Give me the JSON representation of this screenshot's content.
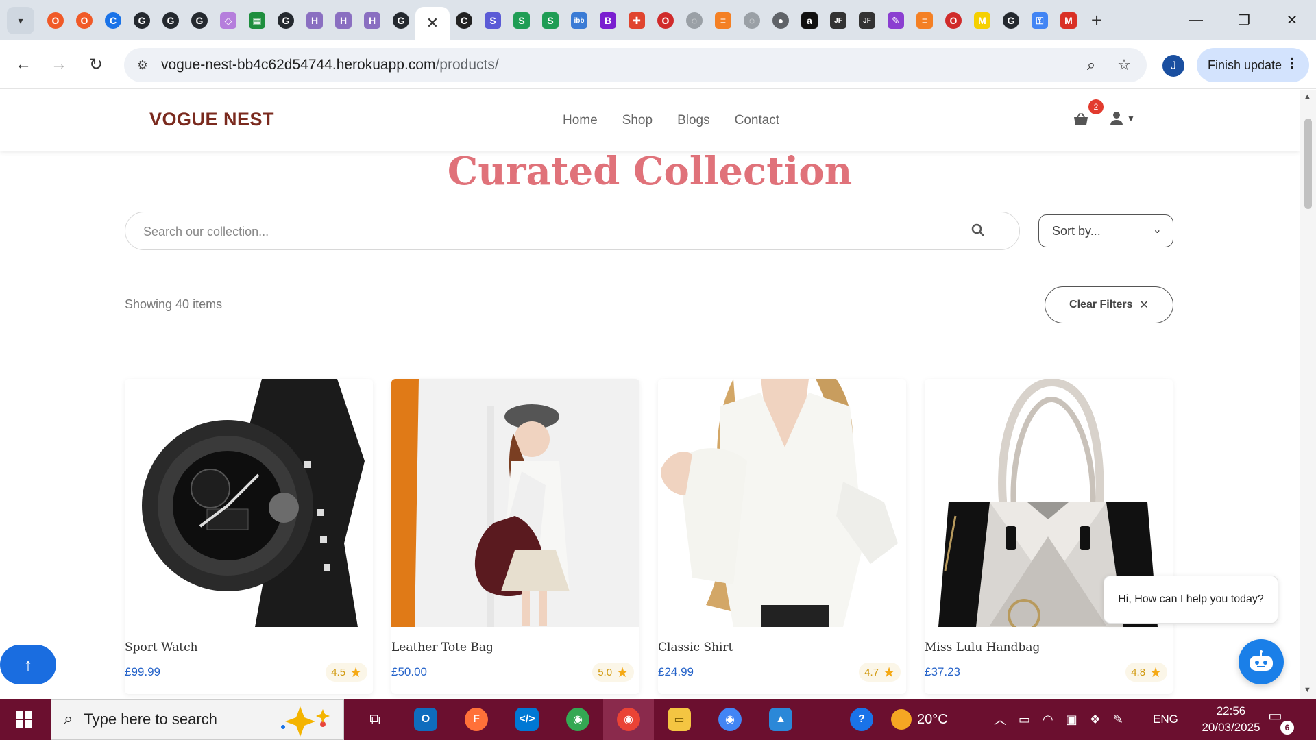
{
  "browser": {
    "tab_favicons": [
      {
        "name": "opera-red-icon",
        "color": "#f05a28",
        "glyph": "O",
        "round": true
      },
      {
        "name": "opera-red-icon",
        "color": "#f05a28",
        "glyph": "O",
        "round": true
      },
      {
        "name": "chrome-blue-icon",
        "color": "#1a73e8",
        "glyph": "C",
        "round": true
      },
      {
        "name": "github-icon",
        "color": "#24292f",
        "glyph": "G",
        "round": true
      },
      {
        "name": "github-icon",
        "color": "#24292f",
        "glyph": "G",
        "round": true
      },
      {
        "name": "github-icon",
        "color": "#24292f",
        "glyph": "G",
        "round": true
      },
      {
        "name": "cube-icon",
        "color": "#b57edc",
        "glyph": "◇",
        "round": false
      },
      {
        "name": "sheets-icon",
        "color": "#1e8e3e",
        "glyph": "▦",
        "round": false
      },
      {
        "name": "github-icon",
        "color": "#24292f",
        "glyph": "G",
        "round": true
      },
      {
        "name": "heroku-icon",
        "color": "#8a6fc1",
        "glyph": "H",
        "round": false
      },
      {
        "name": "heroku-icon",
        "color": "#8a6fc1",
        "glyph": "H",
        "round": false
      },
      {
        "name": "heroku-icon",
        "color": "#8a6fc1",
        "glyph": "H",
        "round": false
      },
      {
        "name": "github-icon",
        "color": "#24292f",
        "glyph": "G",
        "round": true
      }
    ],
    "active_tab_icon": "close-icon",
    "tab_favicons_after": [
      {
        "name": "c-icon",
        "color": "#222222",
        "glyph": "C",
        "round": true
      },
      {
        "name": "s-purple-icon",
        "color": "#5b5bd6",
        "glyph": "S",
        "round": false
      },
      {
        "name": "s-green-icon",
        "color": "#1f9d55",
        "glyph": "S",
        "round": false
      },
      {
        "name": "s-green-icon",
        "color": "#1f9d55",
        "glyph": "S",
        "round": false
      },
      {
        "name": "ibb-icon",
        "color": "#3a7bd5",
        "glyph": "ibb",
        "round": false
      },
      {
        "name": "bootstrap-icon",
        "color": "#7a1fd0",
        "glyph": "B",
        "round": false
      },
      {
        "name": "puzzle-icon",
        "color": "#e0452f",
        "glyph": "✚",
        "round": false
      },
      {
        "name": "opera-icon",
        "color": "#d02b2b",
        "glyph": "O",
        "round": true
      },
      {
        "name": "loading-icon",
        "color": "#9aa0a6",
        "glyph": "◌",
        "round": true
      },
      {
        "name": "stackoverflow-icon",
        "color": "#f48024",
        "glyph": "≡",
        "round": false
      },
      {
        "name": "loading-icon",
        "color": "#9aa0a6",
        "glyph": "◌",
        "round": true
      },
      {
        "name": "globe-icon",
        "color": "#5f6368",
        "glyph": "●",
        "round": true
      },
      {
        "name": "amazon-icon",
        "color": "#111111",
        "glyph": "a",
        "round": false
      },
      {
        "name": "jf-icon",
        "color": "#333333",
        "glyph": "JF",
        "round": false
      },
      {
        "name": "jf-icon",
        "color": "#333333",
        "glyph": "JF",
        "round": false
      },
      {
        "name": "pen-icon",
        "color": "#8b3fd1",
        "glyph": "✎",
        "round": false
      },
      {
        "name": "stackoverflow-icon",
        "color": "#f48024",
        "glyph": "≡",
        "round": false
      },
      {
        "name": "opera-icon",
        "color": "#d02b2b",
        "glyph": "O",
        "round": true
      },
      {
        "name": "miro-icon",
        "color": "#f5d000",
        "glyph": "M",
        "round": false
      },
      {
        "name": "github-icon",
        "color": "#24292f",
        "glyph": "G",
        "round": true
      },
      {
        "name": "key-icon",
        "color": "#4285f4",
        "glyph": "⚿",
        "round": false
      },
      {
        "name": "gmail-icon",
        "color": "#d93025",
        "glyph": "M",
        "round": false
      }
    ],
    "url_host": "vogue-nest-bb4c62d54744.herokuapp.com",
    "url_path": "/products/",
    "profile_initial": "J",
    "finish_update_label": "Finish update"
  },
  "site": {
    "brand": "VOGUE NEST",
    "nav": [
      "Home",
      "Shop",
      "Blogs",
      "Contact"
    ],
    "cart_count": "2"
  },
  "page": {
    "title": "Curated Collection",
    "search_placeholder": "Search our collection...",
    "sort_label": "Sort by...",
    "showing_text": "Showing 40 items",
    "clear_filters_label": "Clear Filters"
  },
  "products": [
    {
      "name": "Sport Watch",
      "price": "£99.99",
      "rating": "4.5"
    },
    {
      "name": "Leather Tote Bag",
      "price": "£50.00",
      "rating": "5.0"
    },
    {
      "name": "Classic Shirt",
      "price": "£24.99",
      "rating": "4.7"
    },
    {
      "name": "Miss Lulu Handbag",
      "price": "£37.23",
      "rating": "4.8"
    }
  ],
  "chat": {
    "greeting": "Hi, How can I help you today?"
  },
  "taskbar": {
    "search_placeholder": "Type here to search",
    "weather_temp": "20°C",
    "language": "ENG",
    "time": "22:56",
    "date": "20/03/2025",
    "notification_count": "6"
  },
  "colors": {
    "brand": "#7a2a1e",
    "title": "#e0727a",
    "price": "#2563c9",
    "accent_blue": "#1a6de0",
    "taskbar": "#6b0f2f"
  }
}
